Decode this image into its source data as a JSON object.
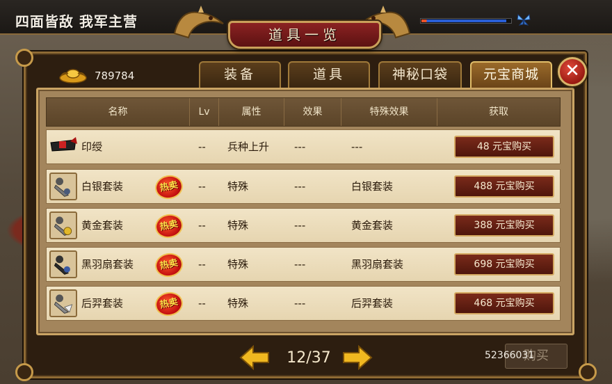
{
  "scene": {
    "title": "四面皆敌  我军主营"
  },
  "window": {
    "title": "道具一览"
  },
  "hp_bar": {
    "fill_fraction": 0.95
  },
  "currency": {
    "gold_amount": "789784"
  },
  "tabs": [
    {
      "label": "装备",
      "active": false
    },
    {
      "label": "道具",
      "active": false
    },
    {
      "label": "神秘口袋",
      "active": false
    },
    {
      "label": "元宝商城",
      "active": true
    }
  ],
  "table": {
    "headers": [
      "名称",
      "Lv",
      "属性",
      "效果",
      "特殊效果",
      "获取"
    ],
    "hot_label": "热卖",
    "rows": [
      {
        "name": "印绶",
        "lv": "--",
        "attr": "兵种上升",
        "effect": "---",
        "special": "---",
        "buy": "48 元宝购买",
        "hot": false,
        "icon": "seal-ribbon-icon"
      },
      {
        "name": "白银套装",
        "lv": "--",
        "attr": "特殊",
        "effect": "---",
        "special": "白银套装",
        "buy": "488 元宝购买",
        "hot": true,
        "icon": "silver-armor-set-icon"
      },
      {
        "name": "黄金套装",
        "lv": "--",
        "attr": "特殊",
        "effect": "---",
        "special": "黄金套装",
        "buy": "388 元宝购买",
        "hot": true,
        "icon": "gold-armor-set-icon"
      },
      {
        "name": "黑羽扇套装",
        "lv": "--",
        "attr": "特殊",
        "effect": "---",
        "special": "黑羽扇套装",
        "buy": "698 元宝购买",
        "hot": true,
        "icon": "black-feather-fan-set-icon"
      },
      {
        "name": "后羿套装",
        "lv": "--",
        "attr": "特殊",
        "effect": "---",
        "special": "后羿套装",
        "buy": "468 元宝购买",
        "hot": true,
        "icon": "houyi-armor-set-icon"
      }
    ]
  },
  "pagination": {
    "current": "12/37"
  },
  "footer": {
    "number": "52366031",
    "button_label": "购买"
  },
  "colors": {
    "accent_gold": "#caa464",
    "button_red": "#7a2a1a",
    "active_tab": "#9a6a2a"
  }
}
